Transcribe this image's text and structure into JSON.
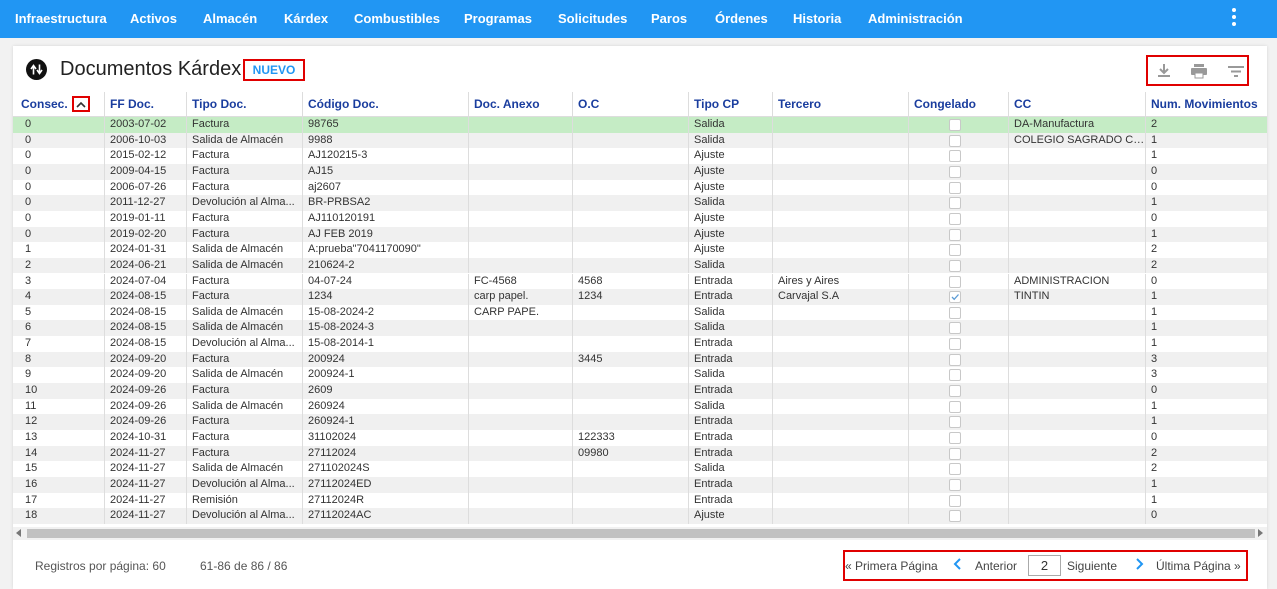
{
  "nav": {
    "items": [
      "Infraestructura",
      "Activos",
      "Almacén",
      "Kárdex",
      "Combustibles",
      "Programas",
      "Solicitudes",
      "Paros",
      "Órdenes",
      "Historia",
      "Administración"
    ]
  },
  "header": {
    "title": "Documentos Kárdex",
    "new_button": "NUEVO"
  },
  "toolbar_icons": [
    "download-icon",
    "print-icon",
    "filter-icon"
  ],
  "grid": {
    "columns": [
      "Consec.",
      "FF Doc.",
      "Tipo Doc.",
      "Código Doc.",
      "Doc. Anexo",
      "O.C",
      "Tipo CP",
      "Tercero",
      "Congelado",
      "CC",
      "Num. Movimientos"
    ],
    "rows": [
      {
        "consec": "0",
        "ff": "2003-07-02",
        "tipo": "Factura",
        "codigo": "98765",
        "anexo": "",
        "oc": "",
        "tipocp": "Salida",
        "tercero": "",
        "congelado": false,
        "cc": "DA-Manufactura",
        "mov": "2"
      },
      {
        "consec": "0",
        "ff": "2006-10-03",
        "tipo": "Salida de Almacén",
        "codigo": "9988",
        "anexo": "",
        "oc": "",
        "tipocp": "Salida",
        "tercero": "",
        "congelado": false,
        "cc": "COLEGIO SAGRADO CO...",
        "mov": "1"
      },
      {
        "consec": "0",
        "ff": "2015-02-12",
        "tipo": "Factura",
        "codigo": "AJ120215-3",
        "anexo": "",
        "oc": "",
        "tipocp": "Ajuste",
        "tercero": "",
        "congelado": false,
        "cc": "",
        "mov": "1"
      },
      {
        "consec": "0",
        "ff": "2009-04-15",
        "tipo": "Factura",
        "codigo": "AJ15",
        "anexo": "",
        "oc": "",
        "tipocp": "Ajuste",
        "tercero": "",
        "congelado": false,
        "cc": "",
        "mov": "0"
      },
      {
        "consec": "0",
        "ff": "2006-07-26",
        "tipo": "Factura",
        "codigo": "aj2607",
        "anexo": "",
        "oc": "",
        "tipocp": "Ajuste",
        "tercero": "",
        "congelado": false,
        "cc": "",
        "mov": "0"
      },
      {
        "consec": "0",
        "ff": "2011-12-27",
        "tipo": "Devolución al Alma...",
        "codigo": "BR-PRBSA2",
        "anexo": "",
        "oc": "",
        "tipocp": "Salida",
        "tercero": "",
        "congelado": false,
        "cc": "",
        "mov": "1"
      },
      {
        "consec": "0",
        "ff": "2019-01-11",
        "tipo": "Factura",
        "codigo": "AJ110120191",
        "anexo": "",
        "oc": "",
        "tipocp": "Ajuste",
        "tercero": "",
        "congelado": false,
        "cc": "",
        "mov": "0"
      },
      {
        "consec": "0",
        "ff": "2019-02-20",
        "tipo": "Factura",
        "codigo": "AJ FEB 2019",
        "anexo": "",
        "oc": "",
        "tipocp": "Ajuste",
        "tercero": "",
        "congelado": false,
        "cc": "",
        "mov": "1"
      },
      {
        "consec": "1",
        "ff": "2024-01-31",
        "tipo": "Salida de Almacén",
        "codigo": "A:prueba\"7041170090\"",
        "anexo": "",
        "oc": "",
        "tipocp": "Ajuste",
        "tercero": "",
        "congelado": false,
        "cc": "",
        "mov": "2"
      },
      {
        "consec": "2",
        "ff": "2024-06-21",
        "tipo": "Salida de Almacén",
        "codigo": "210624-2",
        "anexo": "",
        "oc": "",
        "tipocp": "Salida",
        "tercero": "",
        "congelado": false,
        "cc": "",
        "mov": "2"
      },
      {
        "consec": "3",
        "ff": "2024-07-04",
        "tipo": "Factura",
        "codigo": "04-07-24",
        "anexo": "FC-4568",
        "oc": "4568",
        "tipocp": "Entrada",
        "tercero": "Aires y Aires",
        "congelado": false,
        "cc": "ADMINISTRACION",
        "mov": "0"
      },
      {
        "consec": "4",
        "ff": "2024-08-15",
        "tipo": "Factura",
        "codigo": "1234",
        "anexo": "carp papel.",
        "oc": "1234",
        "tipocp": "Entrada",
        "tercero": "Carvajal S.A",
        "congelado": true,
        "cc": "TINTIN",
        "mov": "1"
      },
      {
        "consec": "5",
        "ff": "2024-08-15",
        "tipo": "Salida de Almacén",
        "codigo": "15-08-2024-2",
        "anexo": "CARP PAPE.",
        "oc": "",
        "tipocp": "Salida",
        "tercero": "",
        "congelado": false,
        "cc": "",
        "mov": "1"
      },
      {
        "consec": "6",
        "ff": "2024-08-15",
        "tipo": "Salida de Almacén",
        "codigo": "15-08-2024-3",
        "anexo": "",
        "oc": "",
        "tipocp": "Salida",
        "tercero": "",
        "congelado": false,
        "cc": "",
        "mov": "1"
      },
      {
        "consec": "7",
        "ff": "2024-08-15",
        "tipo": "Devolución al Alma...",
        "codigo": "15-08-2014-1",
        "anexo": "",
        "oc": "",
        "tipocp": "Entrada",
        "tercero": "",
        "congelado": false,
        "cc": "",
        "mov": "1"
      },
      {
        "consec": "8",
        "ff": "2024-09-20",
        "tipo": "Factura",
        "codigo": "200924",
        "anexo": "",
        "oc": "3445",
        "tipocp": "Entrada",
        "tercero": "",
        "congelado": false,
        "cc": "",
        "mov": "3"
      },
      {
        "consec": "9",
        "ff": "2024-09-20",
        "tipo": "Salida de Almacén",
        "codigo": "200924-1",
        "anexo": "",
        "oc": "",
        "tipocp": "Salida",
        "tercero": "",
        "congelado": false,
        "cc": "",
        "mov": "3"
      },
      {
        "consec": "10",
        "ff": "2024-09-26",
        "tipo": "Factura",
        "codigo": "2609",
        "anexo": "",
        "oc": "",
        "tipocp": "Entrada",
        "tercero": "",
        "congelado": false,
        "cc": "",
        "mov": "0"
      },
      {
        "consec": "11",
        "ff": "2024-09-26",
        "tipo": "Salida de Almacén",
        "codigo": "260924",
        "anexo": "",
        "oc": "",
        "tipocp": "Salida",
        "tercero": "",
        "congelado": false,
        "cc": "",
        "mov": "1"
      },
      {
        "consec": "12",
        "ff": "2024-09-26",
        "tipo": "Factura",
        "codigo": "260924-1",
        "anexo": "",
        "oc": "",
        "tipocp": "Entrada",
        "tercero": "",
        "congelado": false,
        "cc": "",
        "mov": "1"
      },
      {
        "consec": "13",
        "ff": "2024-10-31",
        "tipo": "Factura",
        "codigo": "31102024",
        "anexo": "",
        "oc": "122333",
        "tipocp": "Entrada",
        "tercero": "",
        "congelado": false,
        "cc": "",
        "mov": "0"
      },
      {
        "consec": "14",
        "ff": "2024-11-27",
        "tipo": "Factura",
        "codigo": "27112024",
        "anexo": "",
        "oc": "09980",
        "tipocp": "Entrada",
        "tercero": "",
        "congelado": false,
        "cc": "",
        "mov": "2"
      },
      {
        "consec": "15",
        "ff": "2024-11-27",
        "tipo": "Salida de Almacén",
        "codigo": "271102024S",
        "anexo": "",
        "oc": "",
        "tipocp": "Salida",
        "tercero": "",
        "congelado": false,
        "cc": "",
        "mov": "2"
      },
      {
        "consec": "16",
        "ff": "2024-11-27",
        "tipo": "Devolución al Alma...",
        "codigo": "27112024ED",
        "anexo": "",
        "oc": "",
        "tipocp": "Entrada",
        "tercero": "",
        "congelado": false,
        "cc": "",
        "mov": "1"
      },
      {
        "consec": "17",
        "ff": "2024-11-27",
        "tipo": "Remisión",
        "codigo": "27112024R",
        "anexo": "",
        "oc": "",
        "tipocp": "Entrada",
        "tercero": "",
        "congelado": false,
        "cc": "",
        "mov": "1"
      },
      {
        "consec": "18",
        "ff": "2024-11-27",
        "tipo": "Devolución al Alma...",
        "codigo": "27112024AC",
        "anexo": "",
        "oc": "",
        "tipocp": "Ajuste",
        "tercero": "",
        "congelado": false,
        "cc": "",
        "mov": "0"
      }
    ]
  },
  "footer": {
    "per_page": "Registros por página: 60",
    "range": "61-86 de 86 / 86",
    "first": "« Primera Página",
    "prev": "Anterior",
    "page": "2",
    "next": "Siguiente",
    "last": "Última Página »"
  },
  "colors": {
    "nav": "#2196f3",
    "header_text": "#1a3d9e",
    "selected_row": "#c5ecc5",
    "highlight_border": "#e00000"
  }
}
